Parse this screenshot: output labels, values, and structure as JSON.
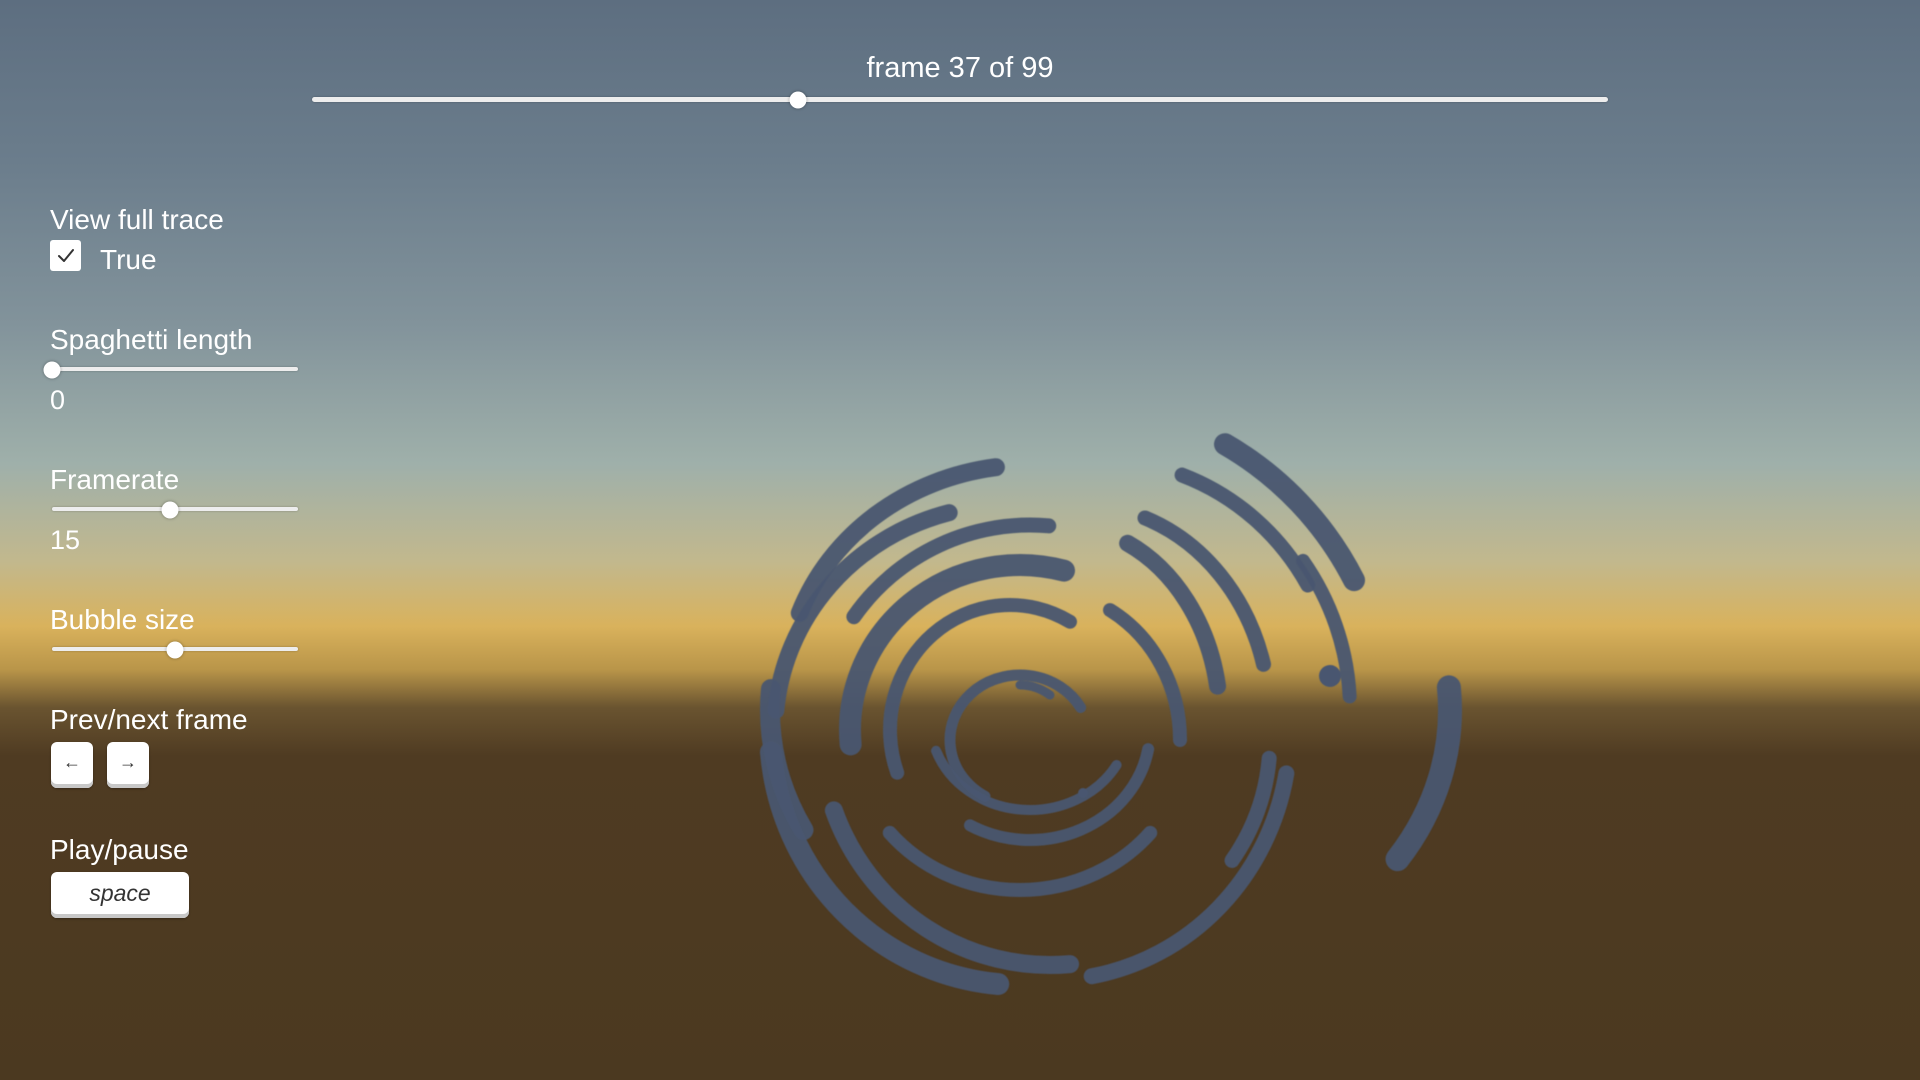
{
  "frame_slider": {
    "label": "frame 37 of 99",
    "current_frame": 37,
    "total_frames": 99,
    "position_fraction": 0.375
  },
  "controls": {
    "view_full_trace": {
      "label": "View full trace",
      "checked": true,
      "value_text": "True"
    },
    "spaghetti_length": {
      "label": "Spaghetti length",
      "value": "0",
      "slider_fraction": 0.0
    },
    "framerate": {
      "label": "Framerate",
      "value": "15",
      "slider_fraction": 0.48
    },
    "bubble_size": {
      "label": "Bubble size",
      "slider_fraction": 0.5
    },
    "prev_next": {
      "label": "Prev/next frame",
      "prev_key": "←",
      "next_key": "→"
    },
    "play_pause": {
      "label": "Play/pause",
      "key": "space"
    }
  },
  "colors": {
    "bubble": "#4a5670",
    "sky_top": "#5d6e80",
    "horizon": "#d9b25c",
    "ground": "#4b3920"
  }
}
